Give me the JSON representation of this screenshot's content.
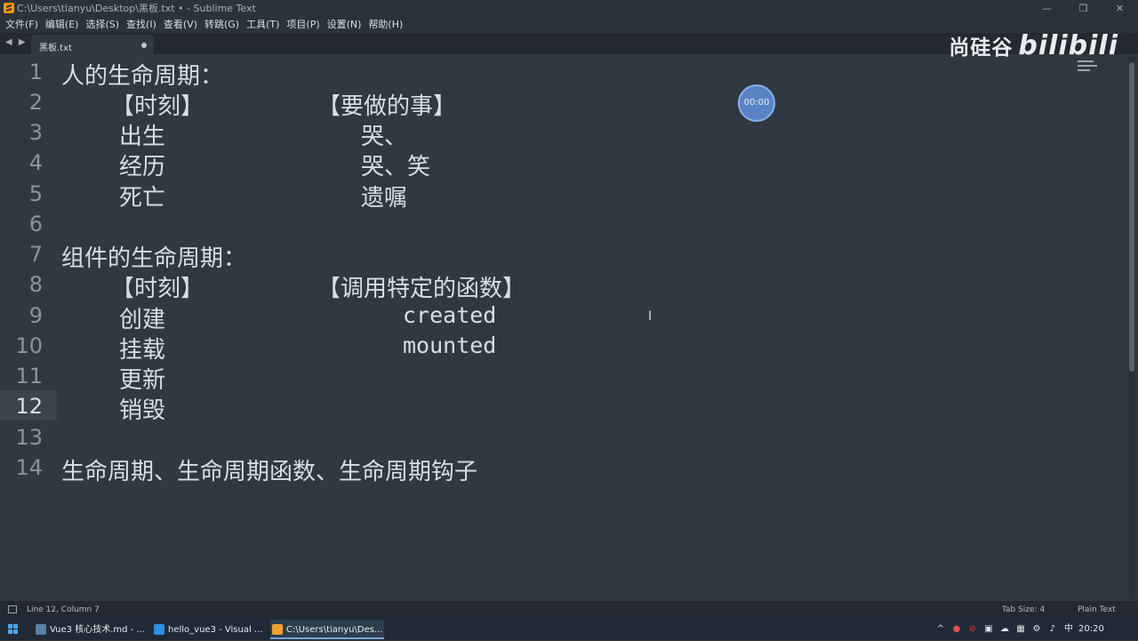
{
  "window": {
    "title": "C:\\Users\\tianyu\\Desktop\\黑板.txt • - Sublime Text",
    "controls": [
      "—",
      "❐",
      "✕"
    ]
  },
  "menu": [
    "文件(F)",
    "编辑(E)",
    "选择(S)",
    "查找(I)",
    "查看(V)",
    "转跳(G)",
    "工具(T)",
    "项目(P)",
    "设置(N)",
    "帮助(H)"
  ],
  "tabs": [
    {
      "label": "黑板.txt",
      "dirty": true
    }
  ],
  "tab_nav": "◀ ▶",
  "watermark": {
    "brand": "尚硅谷",
    "site": "bilibili"
  },
  "timer": "00:00",
  "editor": {
    "current_line": 12,
    "lines": [
      {
        "n": "1",
        "a": "人的生命周期：",
        "b": "",
        "c": "",
        "d": ""
      },
      {
        "n": "2",
        "a": "",
        "b": "【时刻】",
        "c": "【要做的事】",
        "d": ""
      },
      {
        "n": "3",
        "a": "",
        "b": "出生",
        "c": "哭、",
        "d": ""
      },
      {
        "n": "4",
        "a": "",
        "b": "经历",
        "c": "哭、笑",
        "d": ""
      },
      {
        "n": "5",
        "a": "",
        "b": "死亡",
        "c": "遗嘱",
        "d": ""
      },
      {
        "n": "6",
        "a": "",
        "b": "",
        "c": "",
        "d": ""
      },
      {
        "n": "7",
        "a": "组件的生命周期：",
        "b": "",
        "c": "",
        "d": ""
      },
      {
        "n": "8",
        "a": "",
        "b": "【时刻】",
        "c": "【调用特定的函数】",
        "d": ""
      },
      {
        "n": "9",
        "a": "",
        "b": "创建",
        "c": "",
        "d": "created"
      },
      {
        "n": "10",
        "a": "",
        "b": "挂载",
        "c": "",
        "d": "mounted"
      },
      {
        "n": "11",
        "a": "",
        "b": "更新",
        "c": "",
        "d": ""
      },
      {
        "n": "12",
        "a": "",
        "b": "销毁",
        "c": "",
        "d": ""
      },
      {
        "n": "13",
        "a": "",
        "b": "",
        "c": "",
        "d": ""
      },
      {
        "n": "14",
        "a": "生命周期、生命周期函数、生命周期钩子",
        "b": "",
        "c": "",
        "d": ""
      }
    ]
  },
  "status": {
    "position": "Line 12, Column 7",
    "tab_size": "Tab Size: 4",
    "syntax": "Plain Text"
  },
  "taskbar": {
    "items": [
      {
        "label": "Vue3 核心技术.md - ...",
        "color": "#5b7fa6"
      },
      {
        "label": "hello_vue3 - Visual ...",
        "color": "#2f8ee6"
      },
      {
        "label": "C:\\Users\\tianyu\\Des...",
        "color": "#f0a030"
      }
    ],
    "tray": [
      "^",
      "●",
      "⊘",
      "▣",
      "☁",
      "▦",
      "⚙",
      "♪",
      "中"
    ],
    "clock": "20:20"
  }
}
